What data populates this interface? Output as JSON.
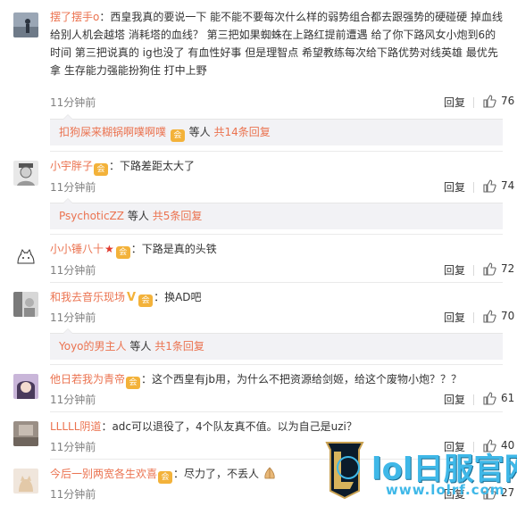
{
  "comments": [
    {
      "username": "摆了摆手o",
      "text": "西皇我真的要说一下 能不能不要每次什么样的弱势组合都去跟强势的硬碰硬 掉血线 给别人机会越塔 消耗塔的血线？ 第三把如果蜘蛛在上路红提前遭遇 给了你下路风女小炮到6的时间 第三把说真的 ig也没了 有血性好事 但是理智点 希望教练每次给下路优势对线英雄 最优先拿 生存能力强能扮狗住 打中上野",
      "time": "11分钟前",
      "reply_label": "回复",
      "likes": "76",
      "avatar_icon": "avatar-person-icon"
    },
    {
      "username": "小宇胖子",
      "text": "下路差距太大了",
      "time": "11分钟前",
      "reply_label": "回复",
      "likes": "74",
      "avatar_icon": "avatar-sketch-icon"
    },
    {
      "username": "小小锤八十",
      "text": "下路是真的头铁",
      "time": "11分钟前",
      "reply_label": "回复",
      "likes": "72",
      "avatar_icon": "avatar-cat-icon"
    },
    {
      "username": "和我去音乐现场",
      "text": "换AD吧",
      "time": "11分钟前",
      "reply_label": "回复",
      "likes": "70",
      "avatar_icon": "avatar-photo-icon"
    },
    {
      "username": "他日若我为青帝",
      "text": "这个西皇有jb用，为什么不把资源给剑姬，给这个废物小炮？？？",
      "time": "11分钟前",
      "reply_label": "回复",
      "likes": "61",
      "avatar_icon": "avatar-anime-icon"
    },
    {
      "username": "LLLLL阴道",
      "text": "adc可以退役了，4个队友真不值。以为自己是uzi？",
      "time": "11分钟前",
      "reply_label": "回复",
      "likes": "40",
      "avatar_icon": "avatar-text-icon"
    },
    {
      "username": "今后一别两宽各生欢喜",
      "text": "尽力了，不丢人",
      "time": "11分钟前",
      "reply_label": "回复",
      "likes": "27",
      "avatar_icon": "avatar-cat2-icon"
    }
  ],
  "subreplies": [
    {
      "name": "扣狗屎来糊锅啊噗啊噗",
      "middle": "等人",
      "count": "共14条回复"
    },
    {
      "name": "PsychoticZZ",
      "middle": "等人",
      "count": "共5条回复"
    },
    {
      "name": "Yoyo的男主人",
      "middle": "等人",
      "count": "共1条回复"
    }
  ],
  "watermark": {
    "title": "lol日服官网",
    "url": "www.lolrf.com",
    "logo_icon": "lol-logo-icon"
  },
  "colors": {
    "username": "#eb7350",
    "badge": "#f3b23a",
    "watermark": "#3fb8e8"
  }
}
